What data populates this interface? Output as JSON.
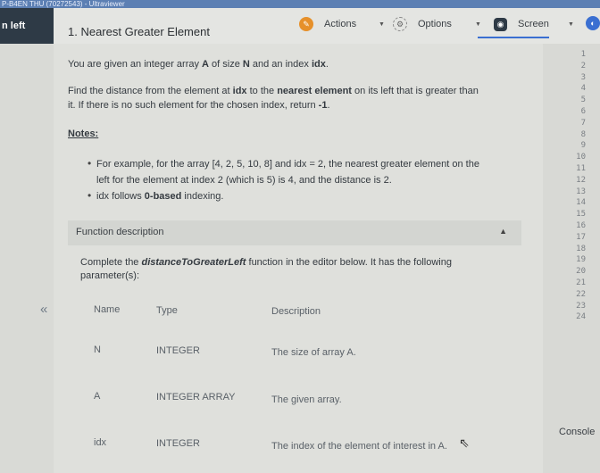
{
  "window": {
    "title": "P-B4EN THU (70272543) - Ultraviewer"
  },
  "left_panel": {
    "label": "n left"
  },
  "toolbar": {
    "actions_label": "Actions",
    "options_label": "Options",
    "screen_label": "Screen",
    "accent_color": "#3a6fd1"
  },
  "problem": {
    "title": "1. Nearest Greater Element",
    "intro_pre": "You are given an integer array ",
    "intro_A": "A",
    "intro_mid": " of size ",
    "intro_N": "N",
    "intro_mid2": " and an index ",
    "intro_idx": "idx",
    "intro_end": ".",
    "task_line1_pre": "Find the distance from the element at ",
    "task_line1_idx": "idx",
    "task_line1_mid": " to the ",
    "task_line1_bold": "nearest element",
    "task_line1_end": " on its left that is greater than",
    "task_line2_pre": "it. If there is no such element for the chosen index, return ",
    "task_line2_bold": "-1",
    "task_line2_end": ".",
    "notes_heading": "Notes:",
    "note1_line1": "For example, for the array [4, 2, 5, 10, 8] and idx = 2, the nearest greater element on the",
    "note1_line2": "left for the element at index 2 (which is 5) is 4, and the distance is 2.",
    "note2_pre": "idx follows ",
    "note2_bold": "0-based",
    "note2_end": " indexing."
  },
  "function_description": {
    "header": "Function description",
    "line1_pre": "Complete the ",
    "line1_fn": "distanceToGreaterLeft",
    "line1_end": " function in the editor below. It has the following",
    "line2": "parameter(s):",
    "columns": [
      "Name",
      "Type",
      "Description"
    ],
    "rows": [
      {
        "name": "N",
        "type": "INTEGER",
        "description": "The size of array A."
      },
      {
        "name": "A",
        "type": "INTEGER ARRAY",
        "description": "The given array."
      },
      {
        "name": "idx",
        "type": "INTEGER",
        "description": "The index of the element of interest in A."
      }
    ]
  },
  "editor": {
    "line_numbers": [
      "1",
      "2",
      "3",
      "4",
      "5",
      "6",
      "7",
      "8",
      "9",
      "10",
      "11",
      "12",
      "13",
      "14",
      "15",
      "16",
      "17",
      "18",
      "19",
      "20",
      "21",
      "22",
      "23",
      "24"
    ],
    "console_label": "Console"
  }
}
